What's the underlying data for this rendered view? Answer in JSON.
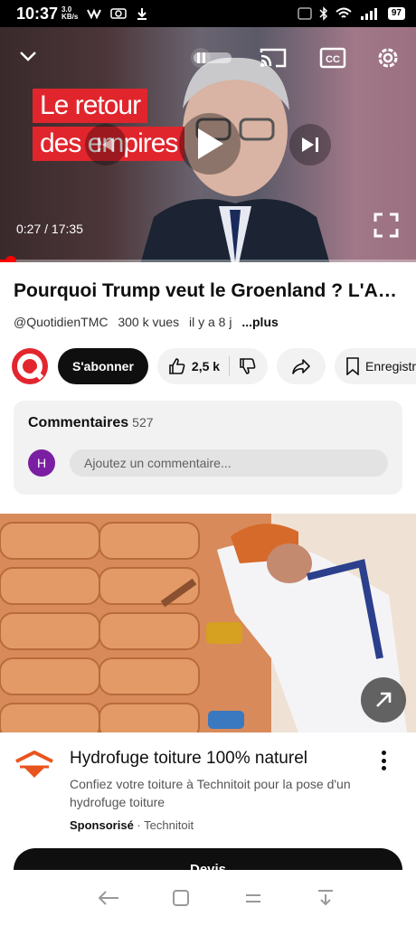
{
  "status_bar": {
    "time": "10:37",
    "speed_value": "3.0",
    "speed_unit": "KB/s",
    "battery": "97",
    "icons": [
      "vibrate-icon",
      "screenshot-icon",
      "download-icon",
      "nfc-icon",
      "bluetooth-icon",
      "wifi-icon",
      "signal-icon"
    ]
  },
  "player": {
    "overlay_line1": "Le retour",
    "overlay_line2": "des empires",
    "current_time": "0:27",
    "duration": "17:35",
    "time_label": "0:27 / 17:35",
    "progress": 0.026,
    "autoplay_toggle": "paused",
    "accent_color": "#ff0000"
  },
  "video": {
    "title": "Pourquoi Trump veut le Groenland ? L'Actu",
    "channel_handle": "@QuotidienTMC",
    "views": "300 k vues",
    "age": "il y a 8 j",
    "more_label": "...plus"
  },
  "actions": {
    "subscribe_label": "S'abonner",
    "likes": "2,5 k",
    "save_label": "Enregistrer"
  },
  "comments": {
    "heading": "Commentaires",
    "count": "527",
    "user_initial": "H",
    "placeholder": "Ajoutez un commentaire..."
  },
  "ad": {
    "title": "Hydrofuge toiture 100% naturel",
    "description": "Confiez votre toiture à Technitoit pour la pose d'un hydrofuge toiture",
    "sponsored_label": "Sponsorisé",
    "separator": "·",
    "advertiser": "Technitoit",
    "cta_label": "Devis",
    "brand_color": "#e8541e"
  }
}
